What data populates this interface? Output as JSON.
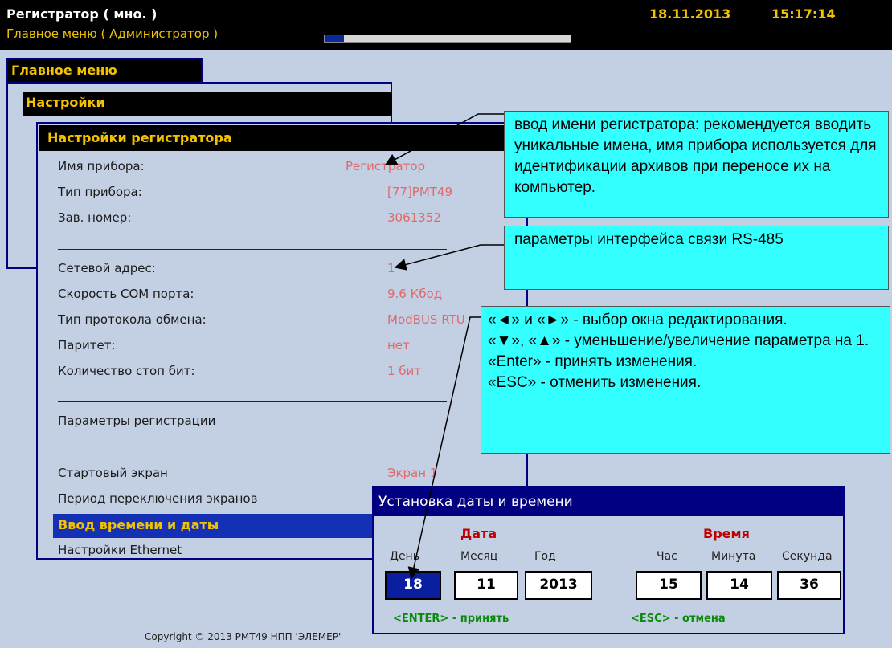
{
  "titlebar": {
    "title": "Регистратор ( мно. )",
    "subtitle": "Главное меню ( Администратор )",
    "date": "18.11.2013",
    "time": "15:17:14",
    "progress": 0.08
  },
  "menus": {
    "main": "Главное меню",
    "settings": "Настройки",
    "registrator": "Настройки регистратора"
  },
  "settings": {
    "device_name": {
      "label": "Имя прибора:",
      "value": "Регистратор"
    },
    "device_type": {
      "label": "Тип прибора:",
      "value": "[77]РМТ49"
    },
    "serial": {
      "label": "Зав. номер:",
      "value": "3061352"
    },
    "net_address": {
      "label": "Сетевой адрес:",
      "value": "1"
    },
    "com_speed": {
      "label": "Скорость COM порта:",
      "value": "9.6 Кбод"
    },
    "protocol": {
      "label": "Тип протокола обмена:",
      "value": "ModBUS RTU"
    },
    "parity": {
      "label": "Паритет:",
      "value": "нет"
    },
    "stop_bits": {
      "label": "Количество стоп бит:",
      "value": "1 бит"
    },
    "reg_params": {
      "label": "Параметры регистрации"
    },
    "start_screen": {
      "label": "Стартовый экран",
      "value": "Экран 1"
    },
    "screen_period": {
      "label": "Период переключения экранов"
    },
    "time_date": {
      "label": "Ввод времени и даты"
    },
    "ethernet": {
      "label": "Настройки Ethernet"
    }
  },
  "callouts": {
    "name": "ввод имени регистратора: рекомендуется вводить уникальные имена, имя прибора используется для идентификации архивов при переносе их на компьютер.",
    "interface": "параметры интерфейса связи RS-485",
    "keys_line1": "«◄» и «►»  - выбор окна редактирования.",
    "keys_line2": "«▼», «▲» - уменьшение/увеличение параметра на 1.",
    "keys_line3": "«Enter» - принять изменения.",
    "keys_line4": "«ESC» - отменить изменения."
  },
  "dialog": {
    "title": "Установка даты и времени",
    "date_group": "Дата",
    "time_group": "Время",
    "day_label": "День",
    "month_label": "Месяц",
    "year_label": "Год",
    "hour_label": "Час",
    "minute_label": "Минута",
    "second_label": "Секунда",
    "day": "18",
    "month": "11",
    "year": "2013",
    "hour": "15",
    "minute": "14",
    "second": "36",
    "enter_hint": "<ENTER> - принять",
    "esc_hint": "<ESC> - отмена"
  },
  "copyright": "Copyright © 2013 РМТ49 НПП 'ЭЛЕМЕР'"
}
